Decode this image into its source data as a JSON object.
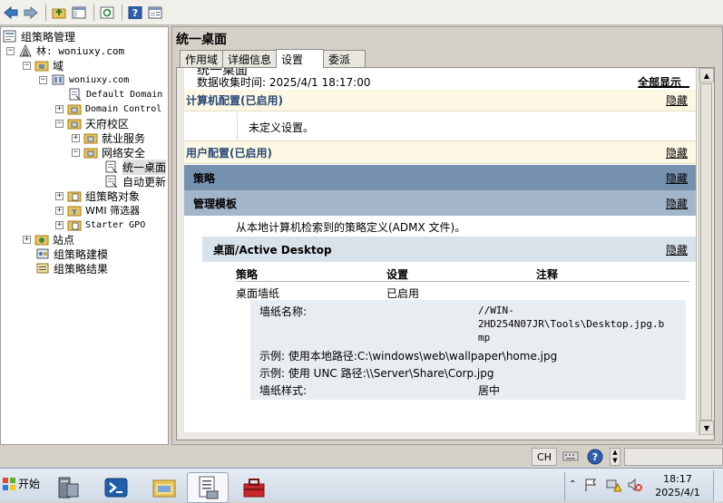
{
  "toolbar": {
    "icons": [
      "back-arrow-icon",
      "forward-arrow-icon",
      "up-folder-icon",
      "show-hide-tree-icon",
      "refresh-icon",
      "help-icon",
      "properties-icon"
    ]
  },
  "tree": {
    "root": "组策略管理",
    "forest": "林: woniuxy.com",
    "domains": "域",
    "domain": "woniuxy.com",
    "default_domain": "Default Domain",
    "domain_controllers": "Domain Control",
    "ou_tianfu": "天府校区",
    "ou_jiuye": "就业服务",
    "ou_wangluo": "网络安全",
    "gpo_unified": "统一桌面",
    "gpo_auto": "自动更新",
    "gpo_objects": "组策略对象",
    "wmi_filters": "WMI 筛选器",
    "starter_gpo": "Starter GPO",
    "sites": "站点",
    "modeling": "组策略建模",
    "results": "组策略结果"
  },
  "right": {
    "title": "统一桌面",
    "tabs": [
      "作用域",
      "详细信息",
      "设置",
      "委派"
    ],
    "active_tab": "设置"
  },
  "report": {
    "heading": "统一桌面",
    "collected": "数据收集时间: 2025/4/1 18:17:00",
    "show_all": "全部显示",
    "hide": "隐藏",
    "computer_config": "计算机配置(已启用)",
    "undefined": "未定义设置。",
    "user_config": "用户配置(已启用)",
    "policies": "策略",
    "admin_templates": "管理模板",
    "admx_note": "从本地计算机检索到的策略定义(ADMX 文件)。",
    "desktop_section": "桌面/Active Desktop",
    "col_policy": "策略",
    "col_setting": "设置",
    "col_comment": "注释",
    "policy_name": "桌面墙纸",
    "policy_state": "已启用",
    "wallpaper_name_label": "墙纸名称:",
    "wallpaper_name_value_1": "//WIN-",
    "wallpaper_name_value_2": "2HD254N07JR\\Tools\\Desktop.jpg.b",
    "wallpaper_name_value_3": "mp",
    "example_local": "示例: 使用本地路径:C:\\windows\\web\\wallpaper\\home.jpg",
    "example_unc": "示例: 使用 UNC 路径:\\\\Server\\Share\\Corp.jpg",
    "style_label": "墙纸样式:",
    "style_value": "居中"
  },
  "status": {
    "lang": "CH"
  },
  "taskbar": {
    "start": "开始",
    "apps": [
      "server-manager-icon",
      "powershell-icon",
      "explorer-icon",
      "gpo-management-icon",
      "toolbox-icon"
    ],
    "time": "18:17",
    "date": "2025/4/1"
  },
  "colors": {
    "config_bar": "#fdf8e3",
    "policy_bar": "#7691ae",
    "admin_bar": "#a3b5c9",
    "desktop_bar": "#d8e2ea",
    "detail_bg": "#e8edf2"
  }
}
